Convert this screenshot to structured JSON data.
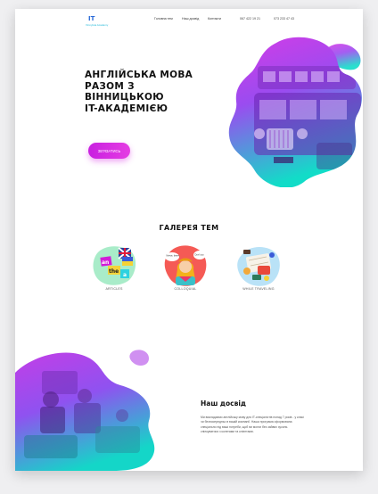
{
  "colors": {
    "accent": "#d92ee0",
    "gradient_top": "#c03ce6",
    "gradient_bottom": "#16d6c8"
  },
  "header": {
    "logo_text": "IT",
    "logo_subtext": "Vinnytsia Academy",
    "nav": [
      "Головна тем",
      "Наш досвід",
      "Контакти"
    ],
    "phones": [
      "067 422 19 21",
      "073 233 47 43"
    ]
  },
  "hero": {
    "title_lines": [
      "АНГЛІЙСЬКА МОВА",
      "РАЗОМ З",
      "ВІННИЦЬКОЮ",
      "IT-АКАДЕМІЄЮ"
    ],
    "cta_label": "ЗВ'ЯЗАТИСЬ"
  },
  "gallery": {
    "title": "ГАЛЕРЕЯ ТЕМ",
    "topics": [
      {
        "label": "ARTICLES",
        "icon": "articles-flags-icon",
        "tiles": [
          "an",
          "the",
          "a"
        ]
      },
      {
        "label": "COLLOQUIAL",
        "icon": "colloquial-girl-icon",
        "bubbles": [
          "Nerve, there",
          "Don't cry"
        ]
      },
      {
        "label": "WHILE TRAVELING",
        "icon": "travel-kit-icon"
      }
    ]
  },
  "experience": {
    "title": "Наш досвід",
    "text": "Ми викладаємо англійську мову для IT-спеціалістів понад 7 років - у класі чи безпосередньо в вашій компанії. Наша програма сформована спеціально під ваші потреби, щоб ви могли без зайвих зусиль спілкуватися з колегами та клієнтами."
  }
}
